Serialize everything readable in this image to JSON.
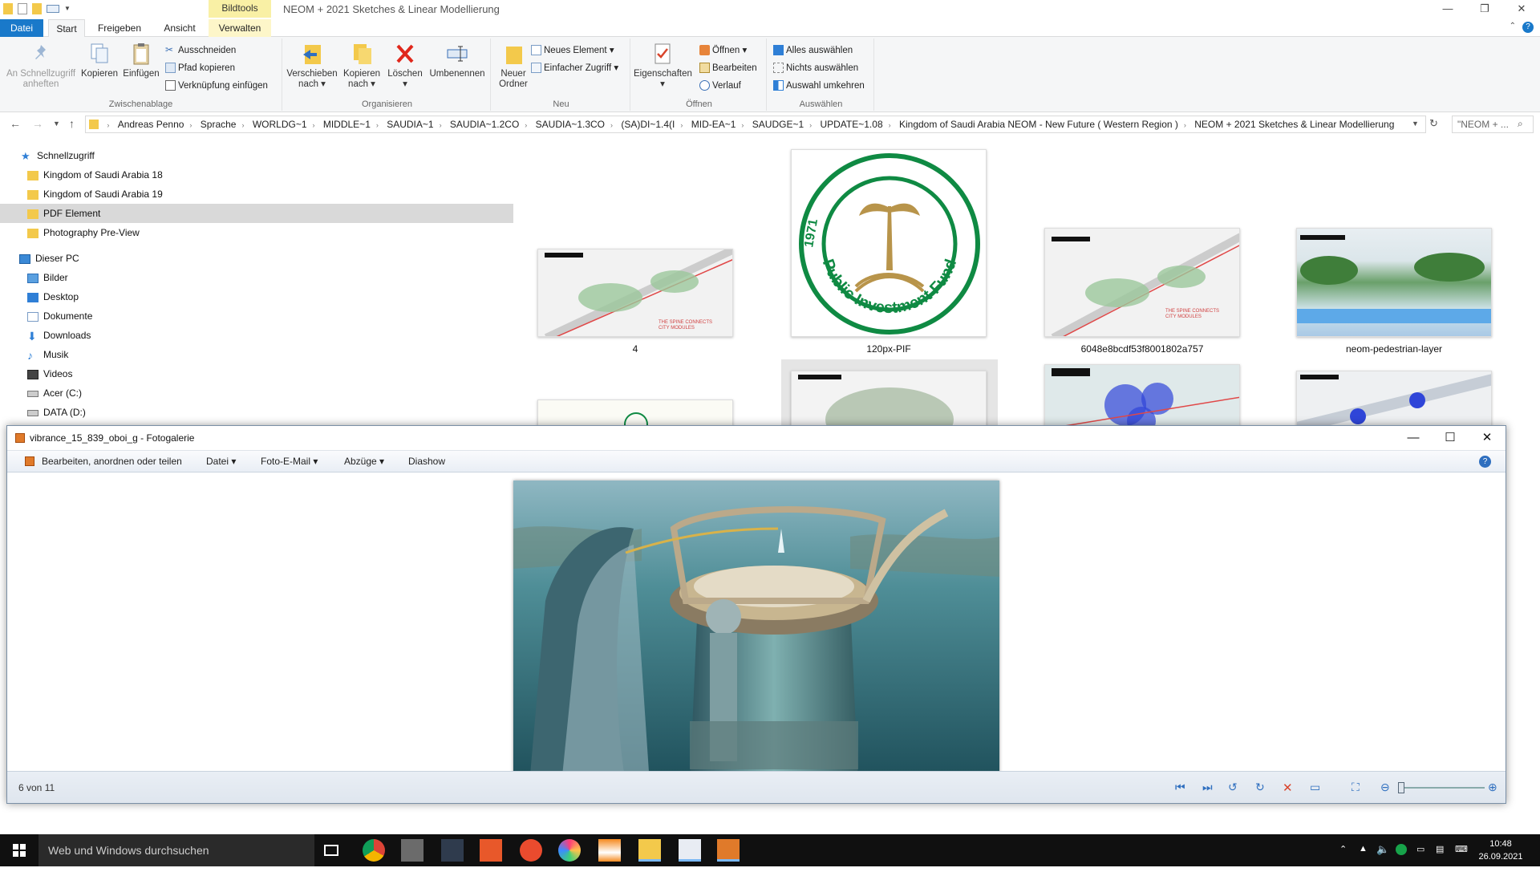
{
  "explorer": {
    "window_title": "NEOM + 2021 Sketches & Linear Modellierung",
    "context_tab": "Bildtools",
    "tabs": [
      "Datei",
      "Start",
      "Freigeben",
      "Ansicht",
      "Verwalten"
    ],
    "ribbon": {
      "clipboard": {
        "label": "Zwischenablage",
        "pin": "An Schnellzugriff anheften",
        "copy": "Kopieren",
        "paste": "Einfügen",
        "cut": "Ausschneiden",
        "copy_path": "Pfad kopieren",
        "paste_shortcut": "Verknüpfung einfügen"
      },
      "organize": {
        "label": "Organisieren",
        "move": "Verschieben nach",
        "copyto": "Kopieren nach",
        "delete": "Löschen",
        "rename": "Umbenennen"
      },
      "new": {
        "label": "Neu",
        "new_folder": "Neuer Ordner",
        "new_item": "Neues Element",
        "easy_access": "Einfacher Zugriff"
      },
      "open": {
        "label": "Öffnen",
        "properties": "Eigenschaften",
        "open": "Öffnen",
        "edit": "Bearbeiten",
        "history": "Verlauf"
      },
      "select": {
        "label": "Auswählen",
        "all": "Alles auswählen",
        "none": "Nichts auswählen",
        "invert": "Auswahl umkehren"
      }
    },
    "breadcrumbs": [
      "Andreas Penno",
      "Sprache",
      "WORLDG~1",
      "MIDDLE~1",
      "SAUDIA~1",
      "SAUDIA~1.2CO",
      "SAUDIA~1.3CO",
      "(SA)DI~1.4(I",
      "MID-EA~1",
      "SAUDGE~1",
      "UPDATE~1.08",
      "Kingdom of Saudi Arabia NEOM - New Future ( Western Region )",
      "NEOM + 2021 Sketches & Linear Modellierung"
    ],
    "search_placeholder": "\"NEOM + ...",
    "nav": {
      "quick_access": "Schnellzugriff",
      "quick_items": [
        "Kingdom of Saudi Arabia 18",
        "Kingdom of Saudi Arabia 19",
        "PDF Element",
        "Photography Pre-View"
      ],
      "this_pc": "Dieser PC",
      "pc_items": [
        "Bilder",
        "Desktop",
        "Dokumente",
        "Downloads",
        "Musik",
        "Videos",
        "Acer (C:)",
        "DATA (D:)"
      ]
    },
    "files": [
      "4",
      "120px-PIF",
      "6048e8bcdf53f8001802a757",
      "neom-pedestrian-layer"
    ],
    "thumb_text": {
      "spine": "THE SPINE CONNECTS CITY MODULES",
      "logo_ring": "Public Investment Fund",
      "logo_year": "1971"
    }
  },
  "gallery": {
    "title": "vibrance_15_839_oboi_g - Fotogalerie",
    "menu": [
      "Bearbeiten, anordnen oder teilen",
      "Datei",
      "Foto-E-Mail",
      "Abzüge",
      "Diashow"
    ],
    "counter": "6 von 11"
  },
  "taskbar": {
    "search": "Web und Windows durchsuchen",
    "time": "10:48",
    "date": "26.09.2021"
  }
}
